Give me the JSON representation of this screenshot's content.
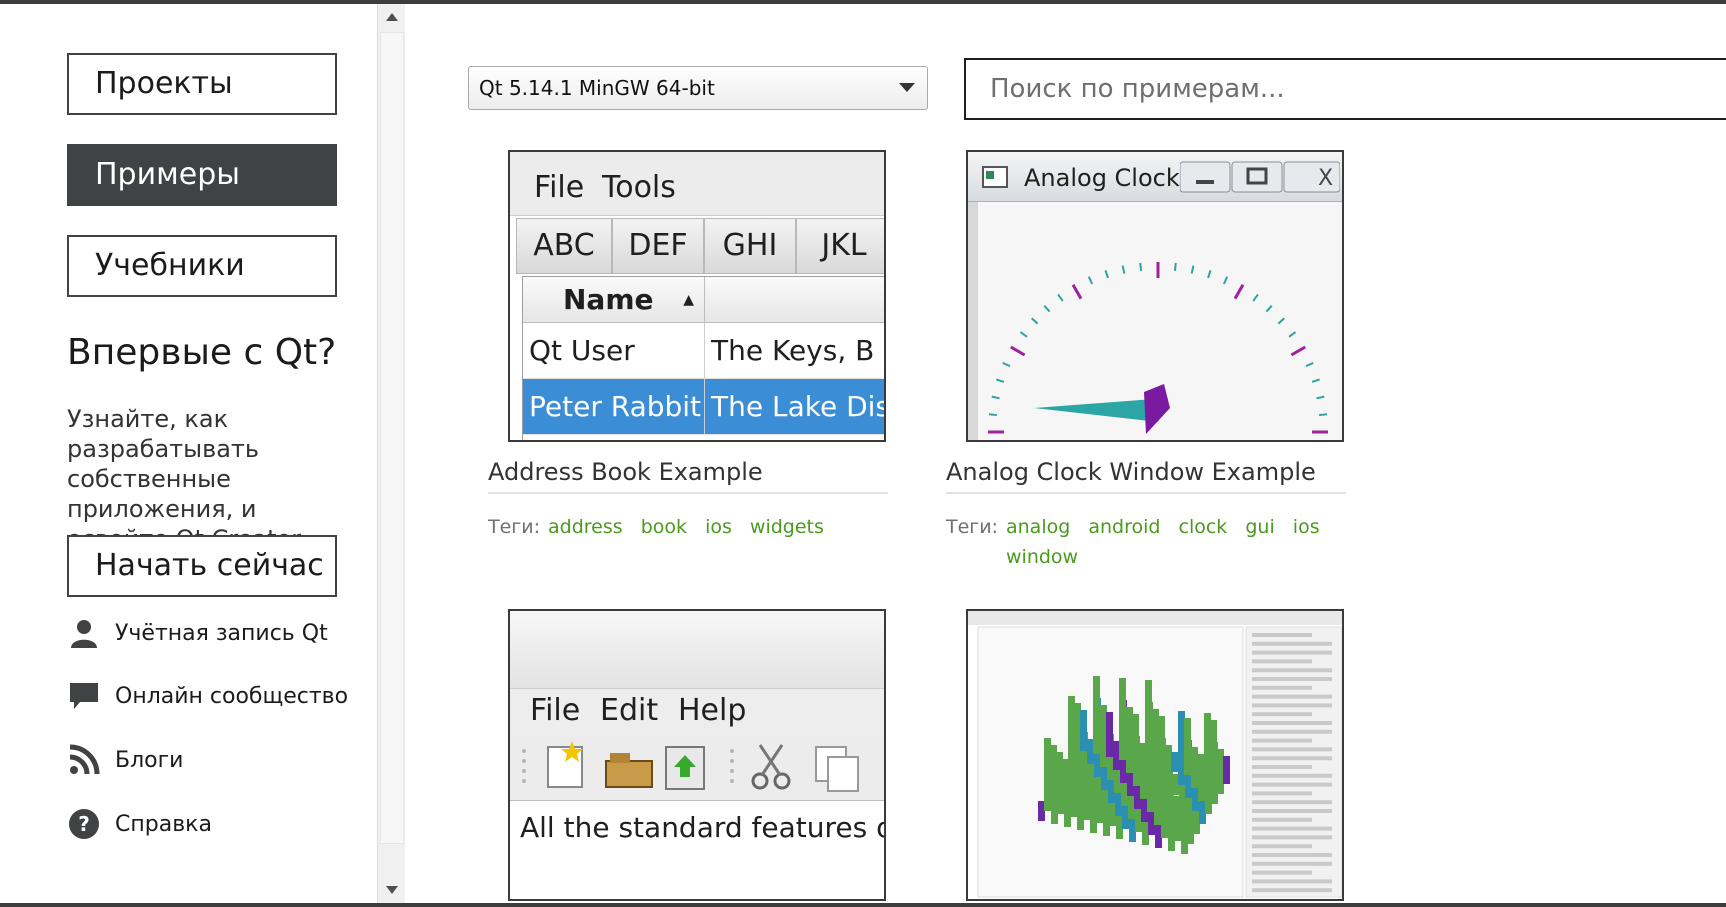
{
  "sidebar": {
    "nav": [
      {
        "label": "Проекты",
        "active": false
      },
      {
        "label": "Примеры",
        "active": true
      },
      {
        "label": "Учебники",
        "active": false
      }
    ],
    "new_title": "Впервые с Qt?",
    "new_desc": "Узнайте, как разрабатывать собственные приложения, и освойте Qt Creator.",
    "start_label": "Начать сейчас",
    "links": [
      {
        "label": "Учётная запись Qt",
        "icon": "user-icon"
      },
      {
        "label": "Онлайн сообщество",
        "icon": "chat-icon"
      },
      {
        "label": "Блоги",
        "icon": "rss-icon"
      },
      {
        "label": "Справка",
        "icon": "help-icon"
      }
    ]
  },
  "toolbar": {
    "kit_selected": "Qt 5.14.1 MinGW 64-bit",
    "search_placeholder": "Поиск по примерам..."
  },
  "tags_label": "Теги:",
  "examples": [
    {
      "title": "Address Book Example",
      "tags": [
        "address",
        "book",
        "ios",
        "widgets"
      ],
      "thumb": {
        "menu": [
          "File",
          "Tools"
        ],
        "tabs": [
          "ABC",
          "DEF",
          "GHI",
          "JKL"
        ],
        "header": "Name",
        "rows": [
          [
            "Qt User",
            "The Keys,  B"
          ],
          [
            "Peter Rabbit",
            "The Lake Dis"
          ]
        ]
      }
    },
    {
      "title": "Analog Clock Window Example",
      "tags": [
        "analog",
        "android",
        "clock",
        "gui",
        "ios",
        "window"
      ],
      "thumb": {
        "window_title": "Analog Clock"
      }
    },
    {
      "title": "",
      "tags": [],
      "thumb": {
        "menu": [
          "File",
          "Edit",
          "Help"
        ],
        "body_text": "All the standard features of"
      }
    },
    {
      "title": "",
      "tags": [],
      "thumb": {}
    }
  ]
}
